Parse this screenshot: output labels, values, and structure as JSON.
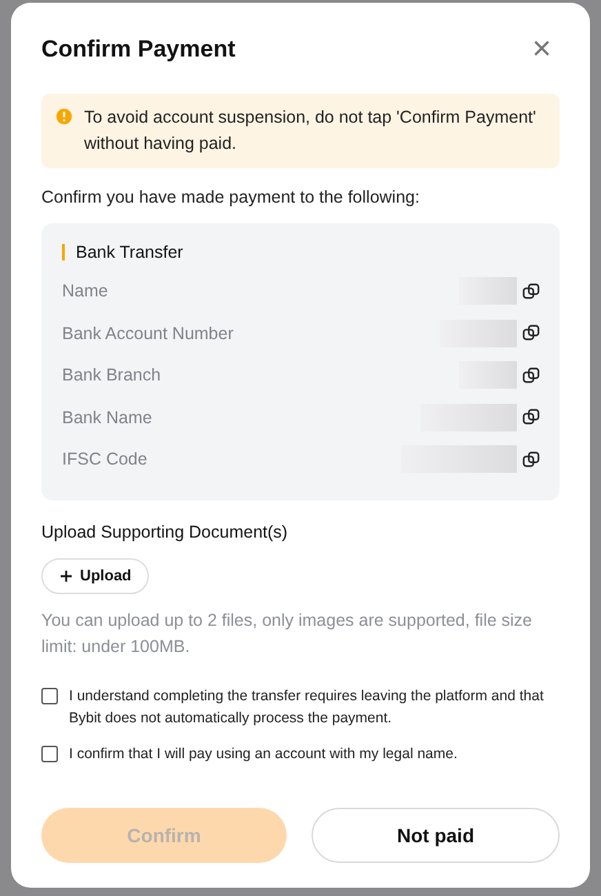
{
  "dialog": {
    "title": "Confirm Payment",
    "close_icon": "×"
  },
  "warning": "To avoid account suspension, do not tap 'Confirm Payment' without having paid.",
  "intro": "Confirm you have made payment to the following:",
  "payment_method": "Bank Transfer",
  "fields": [
    {
      "label": "Name"
    },
    {
      "label": "Bank Account Number"
    },
    {
      "label": "Bank Branch"
    },
    {
      "label": "Bank Name"
    },
    {
      "label": "IFSC Code"
    }
  ],
  "upload": {
    "heading": "Upload Supporting Document(s)",
    "button": "Upload",
    "hint": "You can upload up to 2 files, only images are supported, file size limit: under 100MB."
  },
  "agreements": [
    {
      "text": "I understand completing the transfer requires leaving the platform and that Bybit does not automatically process the payment.",
      "checked": false
    },
    {
      "text": "I confirm that I will pay using an account with my legal name.",
      "checked": false
    }
  ],
  "buttons": [
    {
      "label": "Confirm",
      "kind": "primary",
      "disabled": true
    },
    {
      "label": "Not paid",
      "kind": "secondary",
      "disabled": false
    }
  ]
}
